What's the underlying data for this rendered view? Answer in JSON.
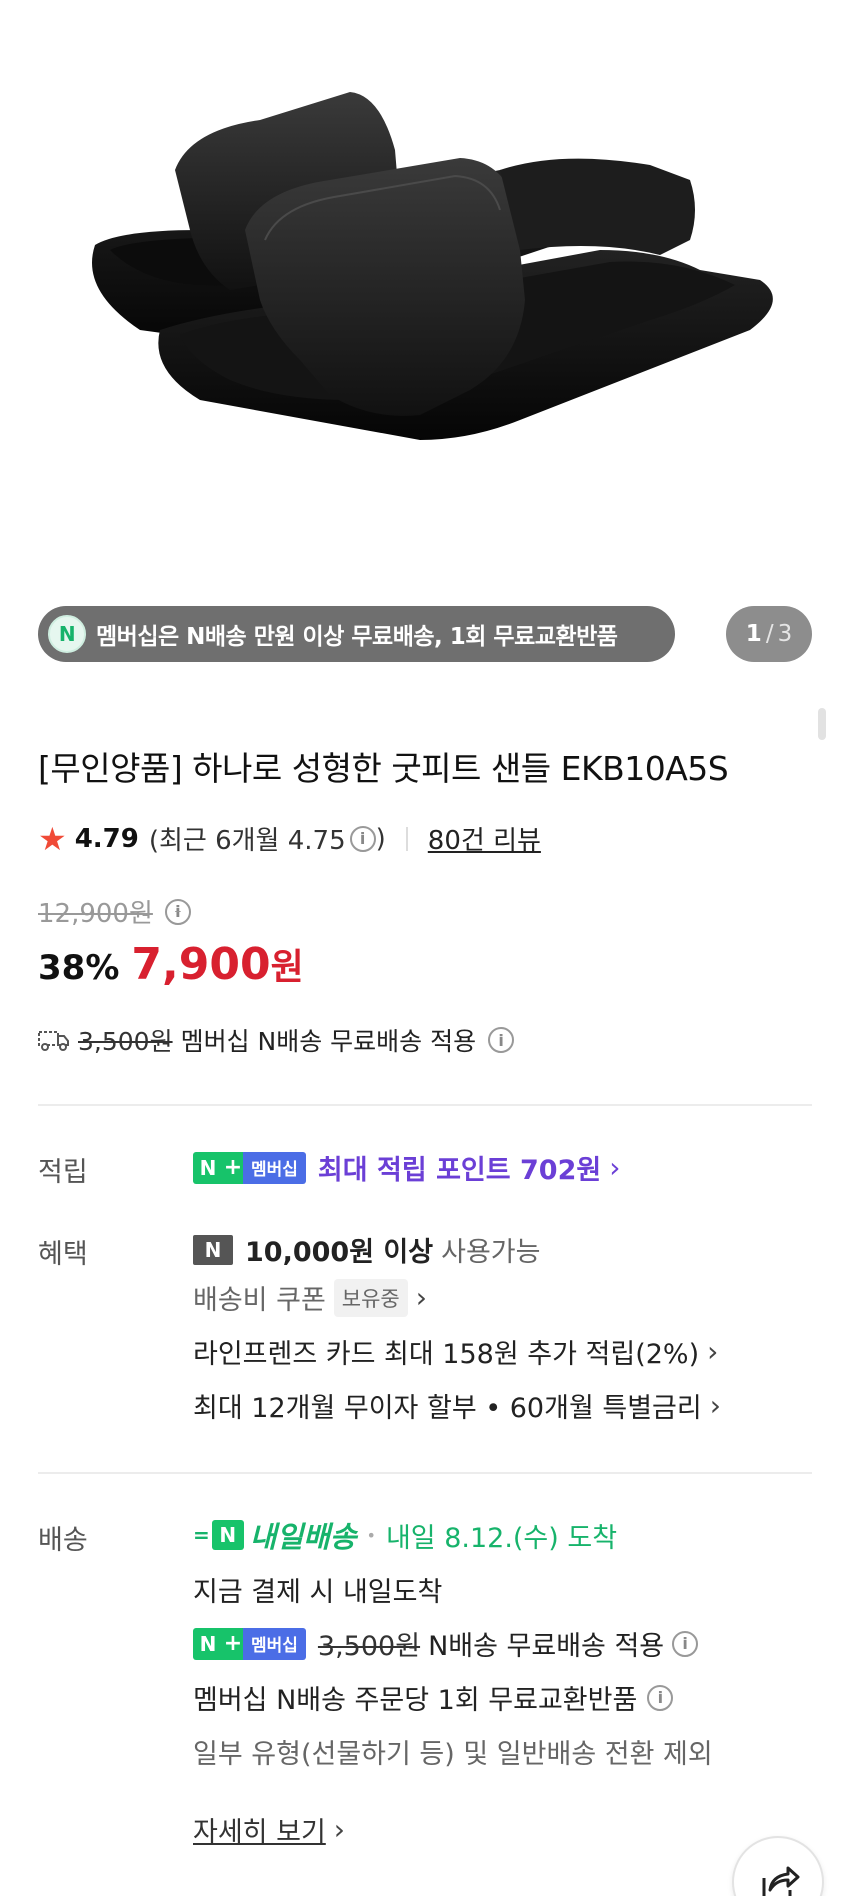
{
  "product": {
    "promo_pill": "멤버십은 N배송 만원 이상 무료배송, 1회 무료교환반품",
    "promo_badge": "N",
    "page_current": "1",
    "page_sep": "/",
    "page_total": "3",
    "title": "[무인양품] 하나로 성형한 굿피트 샌들 EKB10A5S",
    "rating": "4.79",
    "recent_rating": "(최근 6개월 4.75",
    "recent_close": ")",
    "review_count": "80건 리뷰",
    "original_price": "12,900원",
    "discount_rate": "38%",
    "sale_price": "7,900",
    "sale_unit": "원",
    "shipping_old": "3,500원",
    "shipping_text": "멤버십 N배송 무료배송 적용"
  },
  "points": {
    "label": "적립",
    "badge_n": "N",
    "badge_plus": "+",
    "badge_member": "멤버십",
    "text": "최대 적립 포인트 702원"
  },
  "benefits": {
    "label": "혜택",
    "n_badge": "N",
    "coupon_amount": "10,000원 이상",
    "coupon_usable": "사용가능",
    "coupon_name": "배송비 쿠폰",
    "coupon_owned": "보유중",
    "card_text": "라인프렌즈 카드 최대 158원 추가 적립(2%)",
    "installment_text": "최대 12개월 무이자 할부 • 60개월 특별금리"
  },
  "delivery": {
    "label": "배송",
    "speed_mark": "=",
    "n_mark": "N",
    "badge": "내일배송",
    "arrival": "내일 8.12.(수) 도착",
    "pay_now": "지금 결제 시 내일도착",
    "old_fee": "3,500원",
    "free_text": "N배송 무료배송 적용",
    "exchange": "멤버십 N배송 주문당 1회 무료교환반품",
    "exclusion": "일부 유형(선물하기 등) 및 일반배송 전환 제외",
    "details_link": "자세히 보기"
  },
  "icons": {
    "info": "i",
    "star": "★",
    "chevron": "›"
  }
}
